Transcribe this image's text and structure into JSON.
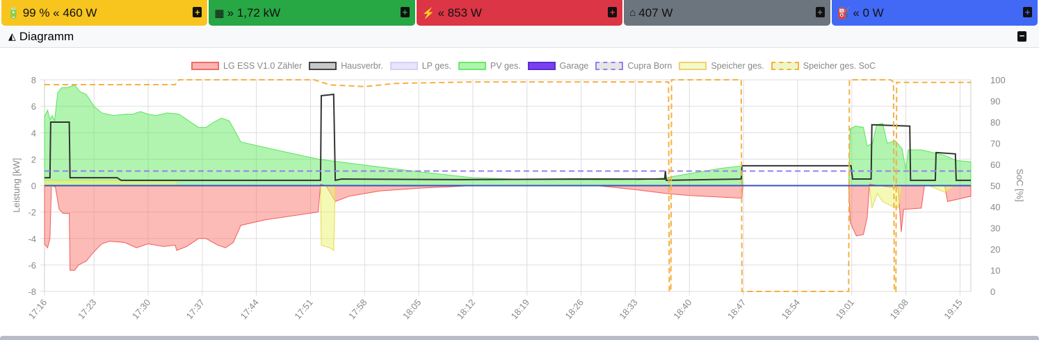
{
  "cards": [
    {
      "icon": "battery-icon",
      "glyph": "🔋",
      "text": "99 % « 460 W",
      "color": "#f8c51f",
      "plus": "+",
      "plus_color": "#f8c51f"
    },
    {
      "icon": "solar-panel-icon",
      "glyph": "▦",
      "text": "» 1,72 kW",
      "color": "#28a745",
      "plus": "+",
      "plus_color": "#28a745"
    },
    {
      "icon": "power-pylon-icon",
      "glyph": "⚡",
      "text": "« 853 W",
      "color": "#dc3545",
      "plus": "+",
      "plus_color": "#dc3545"
    },
    {
      "icon": "home-icon",
      "glyph": "⌂",
      "text": "407 W",
      "color": "#6c757d",
      "plus": "+",
      "plus_color": "#6c757d"
    },
    {
      "icon": "charging-station-icon",
      "glyph": "⛽",
      "text": "« 0 W",
      "color": "#4169f5",
      "plus": "+",
      "plus_color": "#4169f5"
    }
  ],
  "panel": {
    "title": "Diagramm",
    "icon": "chart-area-icon",
    "collapse": "−"
  },
  "chart_data": {
    "type": "area",
    "xlabel": "",
    "ylabel": "Leistung [kW]",
    "y2label": "SoC [%]",
    "xlim": [
      16.6,
      136.4
    ],
    "ylim": [
      -8,
      8
    ],
    "y2lim": [
      0,
      100
    ],
    "yticks": [
      -8,
      -6,
      -4,
      -2,
      0,
      2,
      4,
      6,
      8
    ],
    "y2ticks": [
      0,
      10,
      20,
      30,
      40,
      50,
      60,
      70,
      80,
      90,
      100
    ],
    "xticks": [
      {
        "t": 16.6,
        "label": "17:16"
      },
      {
        "t": 23,
        "label": "17:23"
      },
      {
        "t": 30,
        "label": "17:30"
      },
      {
        "t": 37,
        "label": "17:37"
      },
      {
        "t": 44,
        "label": "17:44"
      },
      {
        "t": 51,
        "label": "17:51"
      },
      {
        "t": 58,
        "label": "17:58"
      },
      {
        "t": 65,
        "label": "18:05"
      },
      {
        "t": 72,
        "label": "18:12"
      },
      {
        "t": 79,
        "label": "18:19"
      },
      {
        "t": 86,
        "label": "18:26"
      },
      {
        "t": 93,
        "label": "18:33"
      },
      {
        "t": 100,
        "label": "18:40"
      },
      {
        "t": 107,
        "label": "18:47"
      },
      {
        "t": 114,
        "label": "18:54"
      },
      {
        "t": 121,
        "label": "19:01"
      },
      {
        "t": 128,
        "label": "19:08"
      },
      {
        "t": 135,
        "label": "19:15"
      }
    ],
    "grid": true,
    "legend_position": "top",
    "series": [
      {
        "name": "PV ges.",
        "style": "area",
        "stroke": "#5be35b",
        "fill": "rgba(80,230,80,0.45)",
        "points": [
          [
            16.6,
            5.2
          ],
          [
            17,
            5.7
          ],
          [
            17.3,
            5.0
          ],
          [
            17.6,
            5.3
          ],
          [
            17.9,
            4.9
          ],
          [
            18.3,
            7.0
          ],
          [
            18.8,
            7.4
          ],
          [
            19.5,
            7.4
          ],
          [
            20.5,
            7.6
          ],
          [
            21.2,
            7.1
          ],
          [
            22,
            6.9
          ],
          [
            23,
            6.0
          ],
          [
            24,
            5.5
          ],
          [
            25.5,
            5.3
          ],
          [
            27,
            5.4
          ],
          [
            28,
            5.4
          ],
          [
            29,
            5.6
          ],
          [
            30,
            5.4
          ],
          [
            31,
            5.3
          ],
          [
            32.5,
            5.5
          ],
          [
            34,
            5.4
          ],
          [
            35,
            5.0
          ],
          [
            36.5,
            4.4
          ],
          [
            37.5,
            4.4
          ],
          [
            38.5,
            4.8
          ],
          [
            39.5,
            5.1
          ],
          [
            40.5,
            4.9
          ],
          [
            42,
            3.3
          ],
          [
            45,
            2.9
          ],
          [
            52,
            2.0
          ],
          [
            56,
            1.7
          ],
          [
            60,
            1.4
          ],
          [
            65,
            1.05
          ],
          [
            72,
            0.6
          ],
          [
            80,
            0.45
          ],
          [
            93,
            0.4
          ],
          [
            97,
            0.6
          ],
          [
            100,
            0.9
          ],
          [
            104,
            1.3
          ],
          [
            106.8,
            1.5
          ],
          [
            106.9,
            0
          ],
          [
            120.6,
            0
          ],
          [
            120.8,
            4.3
          ],
          [
            121.5,
            4.5
          ],
          [
            122.5,
            4.4
          ],
          [
            123,
            3.0
          ],
          [
            123.7,
            3.2
          ],
          [
            124.2,
            4.6
          ],
          [
            125,
            4.7
          ],
          [
            125.6,
            3.2
          ],
          [
            126.6,
            3.4
          ],
          [
            127.5,
            2.8
          ],
          [
            128,
            1.2
          ],
          [
            128.3,
            2.7
          ],
          [
            130,
            2.7
          ],
          [
            133,
            2.3
          ],
          [
            134.5,
            1.9
          ],
          [
            136.4,
            1.8
          ]
        ]
      },
      {
        "name": "LG ESS V1.0 Zähler",
        "style": "area",
        "stroke": "#f25a5a",
        "fill": "rgba(250,120,110,0.5)",
        "points": [
          [
            16.6,
            -4.4
          ],
          [
            17,
            -4.7
          ],
          [
            17.3,
            -4.0
          ],
          [
            17.5,
            0
          ],
          [
            18,
            -0.1
          ],
          [
            18.5,
            -1.8
          ],
          [
            19,
            -2.1
          ],
          [
            19.8,
            -2.1
          ],
          [
            19.9,
            -6.4
          ],
          [
            20.5,
            -6.4
          ],
          [
            21,
            -6.0
          ],
          [
            22,
            -5.7
          ],
          [
            23,
            -5.0
          ],
          [
            24,
            -4.4
          ],
          [
            25,
            -4.2
          ],
          [
            27,
            -4.3
          ],
          [
            28.5,
            -4.7
          ],
          [
            30,
            -4.4
          ],
          [
            32,
            -4.6
          ],
          [
            33.5,
            -4.5
          ],
          [
            33.7,
            -4.9
          ],
          [
            35,
            -4.6
          ],
          [
            36.5,
            -4.0
          ],
          [
            37.5,
            -4.0
          ],
          [
            39,
            -4.5
          ],
          [
            40,
            -4.7
          ],
          [
            41,
            -4.3
          ],
          [
            42,
            -3.0
          ],
          [
            45,
            -2.6
          ],
          [
            52,
            -2.0
          ],
          [
            52.3,
            0.1
          ],
          [
            53,
            0
          ],
          [
            54.2,
            -1.2
          ],
          [
            56,
            -0.8
          ],
          [
            60,
            -0.4
          ],
          [
            65,
            -0.2
          ],
          [
            72,
            0
          ],
          [
            88,
            0
          ],
          [
            93,
            -0.3
          ],
          [
            97,
            -0.6
          ],
          [
            100,
            -0.75
          ],
          [
            106.8,
            -0.95
          ],
          [
            106.9,
            0
          ],
          [
            120.6,
            0
          ],
          [
            120.8,
            -2.8
          ],
          [
            121.6,
            -3.8
          ],
          [
            122.5,
            -3.7
          ],
          [
            123,
            -2.4
          ],
          [
            123.3,
            0.1
          ],
          [
            127,
            -0.2
          ],
          [
            127.4,
            -3.5
          ],
          [
            127.7,
            -1.8
          ],
          [
            130,
            -1.7
          ],
          [
            130.4,
            0
          ],
          [
            133,
            0
          ],
          [
            133.4,
            -1.2
          ],
          [
            136.4,
            -0.8
          ]
        ]
      },
      {
        "name": "Speicher ges.",
        "style": "area",
        "stroke": "#e8d84a",
        "fill": "rgba(235,245,120,0.55)",
        "points": [
          [
            16.6,
            0.4
          ],
          [
            33.7,
            0.4
          ],
          [
            33.8,
            0
          ],
          [
            52.3,
            0
          ],
          [
            52.4,
            -4.5
          ],
          [
            53.5,
            -4.7
          ],
          [
            54,
            -4.9
          ],
          [
            54.2,
            0
          ],
          [
            123.3,
            0
          ],
          [
            123.6,
            -1.7
          ],
          [
            124.3,
            -0.6
          ],
          [
            125,
            -1.2
          ],
          [
            126,
            -1.5
          ],
          [
            127,
            -1.7
          ],
          [
            127.5,
            0
          ],
          [
            131,
            0
          ],
          [
            133,
            -0.5
          ],
          [
            134.5,
            0
          ],
          [
            136.4,
            0
          ]
        ]
      },
      {
        "name": "Hausverbr.",
        "style": "line",
        "stroke": "#333",
        "width": 2,
        "points": [
          [
            16.6,
            0.6
          ],
          [
            17.3,
            0.6
          ],
          [
            17.4,
            4.8
          ],
          [
            19.8,
            4.8
          ],
          [
            19.9,
            0.6
          ],
          [
            26,
            0.6
          ],
          [
            26.5,
            0.4
          ],
          [
            52.3,
            0.4
          ],
          [
            52.4,
            6.8
          ],
          [
            54,
            6.9
          ],
          [
            54.2,
            0.4
          ],
          [
            55,
            0.5
          ],
          [
            70,
            0.45
          ],
          [
            85,
            0.5
          ],
          [
            96.8,
            0.5
          ],
          [
            96.9,
            1.1
          ],
          [
            97,
            0.4
          ],
          [
            106.7,
            0.5
          ],
          [
            106.8,
            1.5
          ],
          [
            120.9,
            1.5
          ],
          [
            121.1,
            0.5
          ],
          [
            123.5,
            0.5
          ],
          [
            123.6,
            4.6
          ],
          [
            128.5,
            4.5
          ],
          [
            128.6,
            0.4
          ],
          [
            131.8,
            0.4
          ],
          [
            131.9,
            2.5
          ],
          [
            134.4,
            2.4
          ],
          [
            134.5,
            0.4
          ],
          [
            136.4,
            0.4
          ]
        ]
      },
      {
        "name": "Cupra Born",
        "style": "dash",
        "stroke": "#9a7bf0",
        "width": 2,
        "points": [
          [
            16.6,
            1.1
          ],
          [
            136.4,
            1.1
          ]
        ]
      },
      {
        "name": "Garage",
        "style": "line",
        "stroke": "#3a4fc0",
        "width": 2,
        "points": [
          [
            16.6,
            0
          ],
          [
            136.4,
            0
          ]
        ]
      },
      {
        "name": "LP ges.",
        "style": "none",
        "stroke": "#cfc6f5",
        "points": []
      },
      {
        "name": "Speicher ges. SoC",
        "style": "dash",
        "axis": "y2",
        "stroke": "#f5b041",
        "width": 2,
        "points": [
          [
            16.6,
            97.7
          ],
          [
            33.5,
            97.7
          ],
          [
            34,
            100
          ],
          [
            51.5,
            100
          ],
          [
            53.5,
            97.6
          ],
          [
            58,
            96.8
          ],
          [
            62,
            98.3
          ],
          [
            72,
            99
          ],
          [
            97.3,
            99
          ],
          [
            97.4,
            0
          ],
          [
            97.6,
            0
          ],
          [
            97.7,
            100
          ],
          [
            106.7,
            100
          ],
          [
            106.8,
            0
          ],
          [
            120.6,
            0
          ],
          [
            120.7,
            100
          ],
          [
            126,
            100
          ],
          [
            126.4,
            99
          ],
          [
            126.5,
            0
          ],
          [
            126.7,
            0
          ],
          [
            126.8,
            98.8
          ],
          [
            136.4,
            98.8
          ]
        ]
      }
    ],
    "legend": [
      {
        "name": "LG ESS V1.0 Zähler",
        "fill": "#fbb5b1",
        "border": "#f06a6a",
        "dash": false
      },
      {
        "name": "Hausverbr.",
        "fill": "#c8c8c8",
        "border": "#444",
        "dash": false
      },
      {
        "name": "LP ges.",
        "fill": "#e8e4fb",
        "border": "#d6cff7",
        "dash": false
      },
      {
        "name": "PV ges.",
        "fill": "#aef5ae",
        "border": "#6ee86e",
        "dash": false
      },
      {
        "name": "Garage",
        "fill": "#7b3ff0",
        "border": "#5a2fd0",
        "dash": false
      },
      {
        "name": "Cupra Born",
        "fill": "#e6e6e6",
        "border": "#9a7bf0",
        "dash": true
      },
      {
        "name": "Speicher ges.",
        "fill": "#f3fac8",
        "border": "#f0d070",
        "dash": false
      },
      {
        "name": "Speicher ges. SoC",
        "fill": "#eef6c8",
        "border": "#f5b041",
        "dash": true
      }
    ]
  }
}
